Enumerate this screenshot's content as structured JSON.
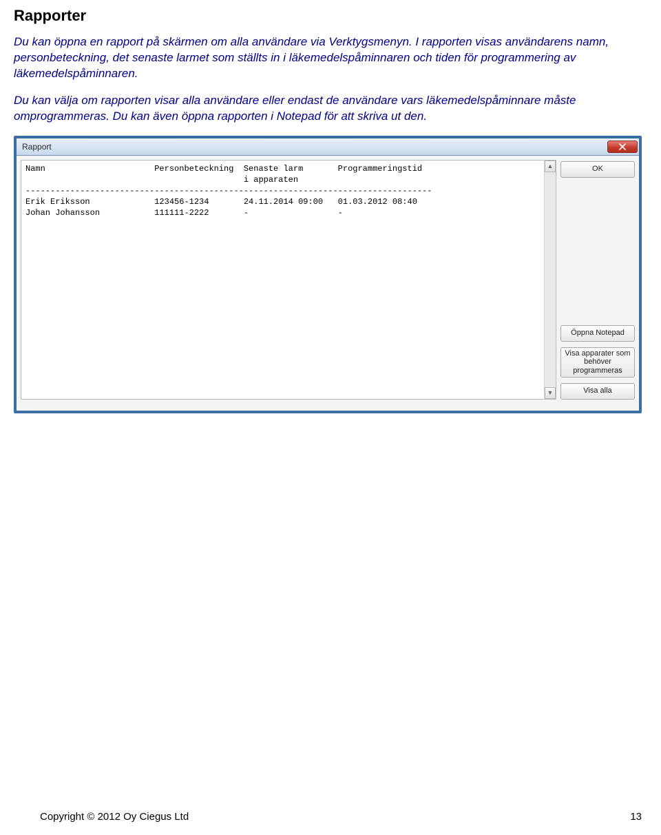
{
  "heading": "Rapporter",
  "paragraph1": "Du kan öppna en rapport på skärmen om alla användare via Verktygsmenyn. I rapporten visas användarens namn, personbeteckning, det senaste larmet som ställts in i läkemedelspåminnaren och tiden för programmering av läkemedelspåminnaren.",
  "paragraph2": "Du kan välja om rapporten visar alla användare eller endast de användare vars läkemedelspåminnare måste omprogrammeras. Du kan även öppna rapporten i Notepad för att skriva ut den.",
  "dialog": {
    "title": "Rapport",
    "buttons": {
      "ok": "OK",
      "open_notepad": "Öppna Notepad",
      "show_need_prog": "Visa apparater som behöver programmeras",
      "show_all": "Visa alla"
    },
    "report_header": {
      "col1": "Namn",
      "col2": "Personbeteckning",
      "col3a": "Senaste larm",
      "col3b": "i apparaten",
      "col4": "Programmeringstid"
    },
    "rows": [
      {
        "name": "Erik Eriksson",
        "pid": "123456-1234",
        "last_alarm": "24.11.2014 09:00",
        "prog_time": "01.03.2012 08:40"
      },
      {
        "name": "Johan Johansson",
        "pid": "111111-2222",
        "last_alarm": "-",
        "prog_time": "-"
      }
    ],
    "separator_width": 82
  },
  "footer": {
    "copyright": "Copyright © 2012 Oy Ciegus Ltd",
    "page": "13"
  }
}
